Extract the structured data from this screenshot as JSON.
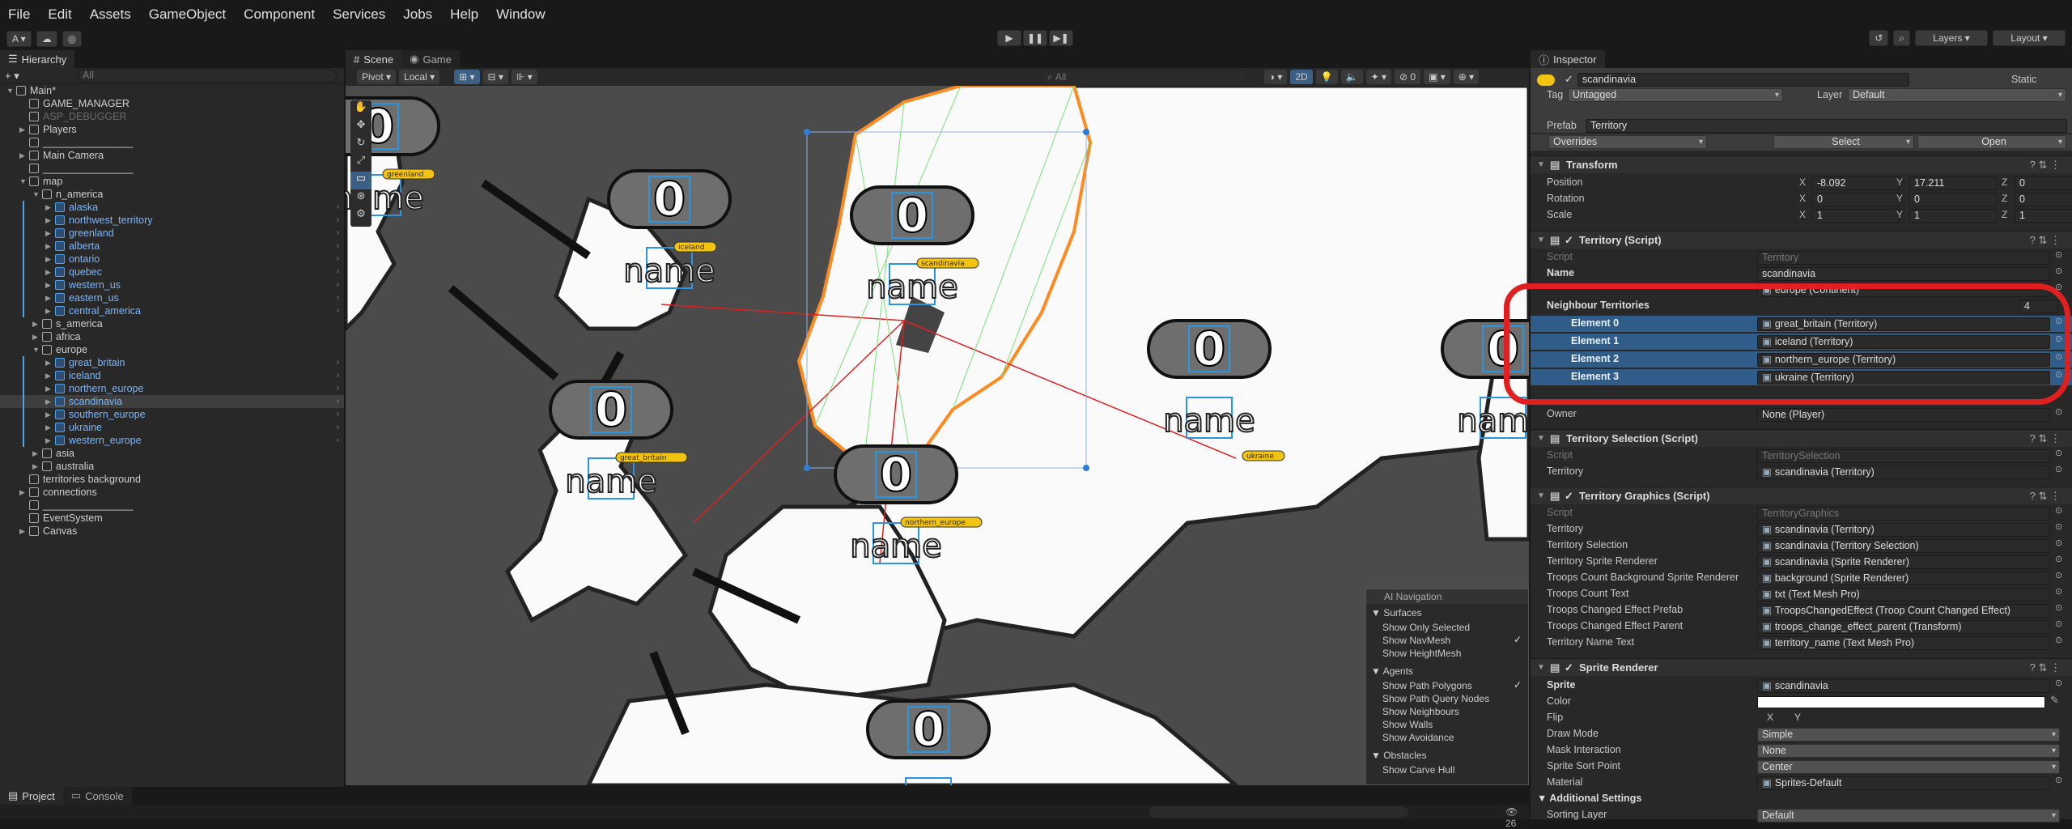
{
  "menu": [
    "File",
    "Edit",
    "Assets",
    "GameObject",
    "Component",
    "Services",
    "Jobs",
    "Help",
    "Window"
  ],
  "toolbar": {
    "account": "A ▾",
    "layers": "Layers",
    "layout": "Layout"
  },
  "hierarchy": {
    "tab": "Hierarchy",
    "search_placeholder": "All",
    "items": [
      {
        "label": "Main*",
        "depth": 0,
        "arrow": "▼",
        "type": "scene"
      },
      {
        "label": "GAME_MANAGER",
        "depth": 1,
        "type": "obj"
      },
      {
        "label": "ASP_DEBUGGER",
        "depth": 1,
        "type": "obj",
        "dim": true
      },
      {
        "label": "Players",
        "depth": 1,
        "arrow": "▶",
        "type": "obj"
      },
      {
        "label": "________________",
        "depth": 1,
        "type": "obj"
      },
      {
        "label": "Main Camera",
        "depth": 1,
        "arrow": "▶",
        "type": "obj"
      },
      {
        "label": "________________",
        "depth": 1,
        "type": "obj"
      },
      {
        "label": "map",
        "depth": 1,
        "arrow": "▼",
        "type": "obj"
      },
      {
        "label": "n_america",
        "depth": 2,
        "arrow": "▼",
        "type": "obj"
      },
      {
        "label": "alaska",
        "depth": 3,
        "arrow": "▶",
        "type": "prefab"
      },
      {
        "label": "northwest_territory",
        "depth": 3,
        "arrow": "▶",
        "type": "prefab"
      },
      {
        "label": "greenland",
        "depth": 3,
        "arrow": "▶",
        "type": "prefab"
      },
      {
        "label": "alberta",
        "depth": 3,
        "arrow": "▶",
        "type": "prefab"
      },
      {
        "label": "ontario",
        "depth": 3,
        "arrow": "▶",
        "type": "prefab"
      },
      {
        "label": "quebec",
        "depth": 3,
        "arrow": "▶",
        "type": "prefab"
      },
      {
        "label": "western_us",
        "depth": 3,
        "arrow": "▶",
        "type": "prefab"
      },
      {
        "label": "eastern_us",
        "depth": 3,
        "arrow": "▶",
        "type": "prefab"
      },
      {
        "label": "central_america",
        "depth": 3,
        "arrow": "▶",
        "type": "prefab"
      },
      {
        "label": "s_america",
        "depth": 2,
        "arrow": "▶",
        "type": "obj"
      },
      {
        "label": "africa",
        "depth": 2,
        "arrow": "▶",
        "type": "obj"
      },
      {
        "label": "europe",
        "depth": 2,
        "arrow": "▼",
        "type": "obj"
      },
      {
        "label": "great_britain",
        "depth": 3,
        "arrow": "▶",
        "type": "prefab"
      },
      {
        "label": "iceland",
        "depth": 3,
        "arrow": "▶",
        "type": "prefab"
      },
      {
        "label": "northern_europe",
        "depth": 3,
        "arrow": "▶",
        "type": "prefab"
      },
      {
        "label": "scandinavia",
        "depth": 3,
        "arrow": "▶",
        "type": "prefab",
        "selected": true
      },
      {
        "label": "southern_europe",
        "depth": 3,
        "arrow": "▶",
        "type": "prefab"
      },
      {
        "label": "ukraine",
        "depth": 3,
        "arrow": "▶",
        "type": "prefab"
      },
      {
        "label": "western_europe",
        "depth": 3,
        "arrow": "▶",
        "type": "prefab"
      },
      {
        "label": "asia",
        "depth": 2,
        "arrow": "▶",
        "type": "obj"
      },
      {
        "label": "australia",
        "depth": 2,
        "arrow": "▶",
        "type": "obj"
      },
      {
        "label": "territories background",
        "depth": 1,
        "type": "obj"
      },
      {
        "label": "connections",
        "depth": 1,
        "arrow": "▶",
        "type": "obj"
      },
      {
        "label": "________________",
        "depth": 1,
        "type": "obj"
      },
      {
        "label": "EventSystem",
        "depth": 1,
        "type": "obj"
      },
      {
        "label": "Canvas",
        "depth": 1,
        "arrow": "▶",
        "type": "obj"
      }
    ]
  },
  "scene": {
    "tab_scene": "Scene",
    "tab_game": "Game",
    "pivot": "Pivot",
    "local": "Local",
    "mode2d": "2D",
    "search_placeholder": "All",
    "nodes": [
      {
        "count": "0",
        "name": "name",
        "label": "greenland"
      },
      {
        "count": "0",
        "name": "name",
        "label": "iceland"
      },
      {
        "count": "0",
        "name": "name",
        "label": "scandinavia"
      },
      {
        "count": "0",
        "name": "name",
        "label": "ukraine"
      },
      {
        "count": "0",
        "name": "name",
        "label": "great_britain"
      },
      {
        "count": "0",
        "name": "name",
        "label": "northern_europe"
      },
      {
        "count": "0",
        "name": "name",
        "label": ""
      },
      {
        "count": "0",
        "name": "name",
        "label": ""
      }
    ],
    "ai_nav": {
      "title": "AI Navigation",
      "surfaces": "Surfaces",
      "show_only_selected": "Show Only Selected",
      "show_navmesh": "Show NavMesh",
      "show_heightmesh": "Show HeightMesh",
      "agents": "Agents",
      "show_path_polygons": "Show Path Polygons",
      "show_path_query_nodes": "Show Path Query Nodes",
      "show_neighbours": "Show Neighbours",
      "show_walls": "Show Walls",
      "show_avoidance": "Show Avoidance",
      "obstacles": "Obstacles",
      "show_carve_hull": "Show Carve Hull"
    }
  },
  "bottom": {
    "tab_project": "Project",
    "tab_console": "Console",
    "count": "26"
  },
  "inspector": {
    "tab": "Inspector",
    "object_name": "scandinavia",
    "static": "Static",
    "tag_label": "Tag",
    "tag": "Untagged",
    "layer_label": "Layer",
    "layer": "Default",
    "prefab_label": "Prefab",
    "prefab": "Territory",
    "overrides": "Overrides",
    "select": "Select",
    "open": "Open",
    "transform": {
      "title": "Transform",
      "position": "Position",
      "rotation": "Rotation",
      "scale": "Scale",
      "px": "-8.092",
      "py": "17.211",
      "pz": "0",
      "rx": "0",
      "ry": "0",
      "rz": "0",
      "sx": "1",
      "sy": "1",
      "sz": "1"
    },
    "territory": {
      "title": "Territory (Script)",
      "script_label": "Script",
      "script": "Territory",
      "name_label": "Name",
      "name": "scandinavia",
      "continent": "europe (Continent)",
      "neighbours_label": "Neighbour Territories",
      "neighbours_count": "4",
      "neighbours": [
        {
          "k": "Element 0",
          "v": "great_britain (Territory)"
        },
        {
          "k": "Element 1",
          "v": "iceland (Territory)"
        },
        {
          "k": "Element 2",
          "v": "northern_europe (Territory)"
        },
        {
          "k": "Element 3",
          "v": "ukraine (Territory)"
        }
      ],
      "owner_label": "Owner",
      "owner": "None (Player)"
    },
    "selection": {
      "title": "Territory Selection (Script)",
      "script_label": "Script",
      "script": "TerritorySelection",
      "territory_label": "Territory",
      "territory": "scandinavia (Territory)"
    },
    "graphics": {
      "title": "Territory Graphics (Script)",
      "rows": [
        {
          "k": "Script",
          "v": "TerritoryGraphics",
          "dis": true
        },
        {
          "k": "Territory",
          "v": "scandinavia (Territory)"
        },
        {
          "k": "Territory Selection",
          "v": "scandinavia (Territory Selection)"
        },
        {
          "k": "Territory Sprite Renderer",
          "v": "scandinavia (Sprite Renderer)"
        },
        {
          "k": "Troops Count Background Sprite Renderer",
          "v": "background (Sprite Renderer)"
        },
        {
          "k": "Troops Count Text",
          "v": "txt (Text Mesh Pro)"
        },
        {
          "k": "Troops Changed Effect Prefab",
          "v": "TroopsChangedEffect (Troop Count Changed Effect)"
        },
        {
          "k": "Troops Changed Effect Parent",
          "v": "troops_change_effect_parent (Transform)"
        },
        {
          "k": "Territory Name Text",
          "v": "territory_name (Text Mesh Pro)"
        }
      ]
    },
    "sprite": {
      "title": "Sprite Renderer",
      "sprite_label": "Sprite",
      "sprite": "scandinavia",
      "color_label": "Color",
      "flip_label": "Flip",
      "flip_x": "X",
      "flip_y": "Y",
      "draw_mode_label": "Draw Mode",
      "draw_mode": "Simple",
      "mask_label": "Mask Interaction",
      "mask": "None",
      "sort_point_label": "Sprite Sort Point",
      "sort_point": "Center",
      "material_label": "Material",
      "material": "Sprites-Default",
      "additional": "Additional Settings",
      "sorting_layer_label": "Sorting Layer",
      "sorting_layer": "Default"
    }
  }
}
